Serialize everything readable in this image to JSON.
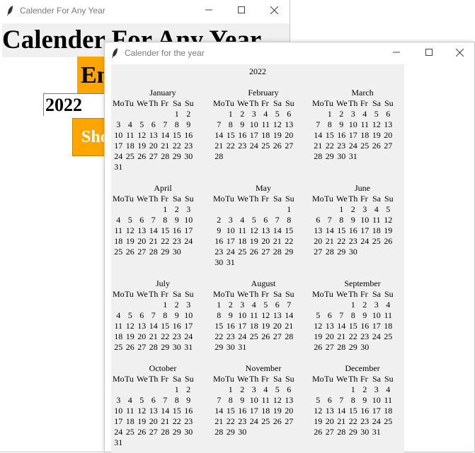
{
  "main_window": {
    "title": "Calender For Any Year",
    "heading": "Calender For Any Year",
    "enter_label": "Enter",
    "year_value": "2022",
    "show_button": "Show"
  },
  "calendar_window": {
    "title": "Calender for the year",
    "year": "2022",
    "day_names": [
      "Mo",
      "Tu",
      "We",
      "Th",
      "Fr",
      "Sa",
      "Su"
    ],
    "months": [
      {
        "name": "January",
        "weeks": [
          [
            "",
            "",
            "",
            "",
            "",
            "1",
            "2"
          ],
          [
            "3",
            "4",
            "5",
            "6",
            "7",
            "8",
            "9"
          ],
          [
            "10",
            "11",
            "12",
            "13",
            "14",
            "15",
            "16"
          ],
          [
            "17",
            "18",
            "19",
            "20",
            "21",
            "22",
            "23"
          ],
          [
            "24",
            "25",
            "26",
            "27",
            "28",
            "29",
            "30"
          ],
          [
            "31",
            "",
            "",
            "",
            "",
            "",
            ""
          ]
        ]
      },
      {
        "name": "February",
        "weeks": [
          [
            "",
            "1",
            "2",
            "3",
            "4",
            "5",
            "6"
          ],
          [
            "7",
            "8",
            "9",
            "10",
            "11",
            "12",
            "13"
          ],
          [
            "14",
            "15",
            "16",
            "17",
            "18",
            "19",
            "20"
          ],
          [
            "21",
            "22",
            "23",
            "24",
            "25",
            "26",
            "27"
          ],
          [
            "28",
            "",
            "",
            "",
            "",
            "",
            ""
          ]
        ]
      },
      {
        "name": "March",
        "weeks": [
          [
            "",
            "1",
            "2",
            "3",
            "4",
            "5",
            "6"
          ],
          [
            "7",
            "8",
            "9",
            "10",
            "11",
            "12",
            "13"
          ],
          [
            "14",
            "15",
            "16",
            "17",
            "18",
            "19",
            "20"
          ],
          [
            "21",
            "22",
            "23",
            "24",
            "25",
            "26",
            "27"
          ],
          [
            "28",
            "29",
            "30",
            "31",
            "",
            "",
            ""
          ]
        ]
      },
      {
        "name": "April",
        "weeks": [
          [
            "",
            "",
            "",
            "",
            "1",
            "2",
            "3"
          ],
          [
            "4",
            "5",
            "6",
            "7",
            "8",
            "9",
            "10"
          ],
          [
            "11",
            "12",
            "13",
            "14",
            "15",
            "16",
            "17"
          ],
          [
            "18",
            "19",
            "20",
            "21",
            "22",
            "23",
            "24"
          ],
          [
            "25",
            "26",
            "27",
            "28",
            "29",
            "30",
            ""
          ]
        ]
      },
      {
        "name": "May",
        "weeks": [
          [
            "",
            "",
            "",
            "",
            "",
            "",
            "1"
          ],
          [
            "2",
            "3",
            "4",
            "5",
            "6",
            "7",
            "8"
          ],
          [
            "9",
            "10",
            "11",
            "12",
            "13",
            "14",
            "15"
          ],
          [
            "16",
            "17",
            "18",
            "19",
            "20",
            "21",
            "22"
          ],
          [
            "23",
            "24",
            "25",
            "26",
            "27",
            "28",
            "29"
          ],
          [
            "30",
            "31",
            "",
            "",
            "",
            "",
            ""
          ]
        ]
      },
      {
        "name": "June",
        "weeks": [
          [
            "",
            "",
            "1",
            "2",
            "3",
            "4",
            "5"
          ],
          [
            "6",
            "7",
            "8",
            "9",
            "10",
            "11",
            "12"
          ],
          [
            "13",
            "14",
            "15",
            "16",
            "17",
            "18",
            "19"
          ],
          [
            "20",
            "21",
            "22",
            "23",
            "24",
            "25",
            "26"
          ],
          [
            "27",
            "28",
            "29",
            "30",
            "",
            "",
            ""
          ]
        ]
      },
      {
        "name": "July",
        "weeks": [
          [
            "",
            "",
            "",
            "",
            "1",
            "2",
            "3"
          ],
          [
            "4",
            "5",
            "6",
            "7",
            "8",
            "9",
            "10"
          ],
          [
            "11",
            "12",
            "13",
            "14",
            "15",
            "16",
            "17"
          ],
          [
            "18",
            "19",
            "20",
            "21",
            "22",
            "23",
            "24"
          ],
          [
            "25",
            "26",
            "27",
            "28",
            "29",
            "30",
            "31"
          ]
        ]
      },
      {
        "name": "August",
        "weeks": [
          [
            "1",
            "2",
            "3",
            "4",
            "5",
            "6",
            "7"
          ],
          [
            "8",
            "9",
            "10",
            "11",
            "12",
            "13",
            "14"
          ],
          [
            "15",
            "16",
            "17",
            "18",
            "19",
            "20",
            "21"
          ],
          [
            "22",
            "23",
            "24",
            "25",
            "26",
            "27",
            "28"
          ],
          [
            "29",
            "30",
            "31",
            "",
            "",
            "",
            ""
          ]
        ]
      },
      {
        "name": "September",
        "weeks": [
          [
            "",
            "",
            "",
            "1",
            "2",
            "3",
            "4"
          ],
          [
            "5",
            "6",
            "7",
            "8",
            "9",
            "10",
            "11"
          ],
          [
            "12",
            "13",
            "14",
            "15",
            "16",
            "17",
            "18"
          ],
          [
            "19",
            "20",
            "21",
            "22",
            "23",
            "24",
            "25"
          ],
          [
            "26",
            "27",
            "28",
            "29",
            "30",
            "",
            ""
          ]
        ]
      },
      {
        "name": "October",
        "weeks": [
          [
            "",
            "",
            "",
            "",
            "",
            "1",
            "2"
          ],
          [
            "3",
            "4",
            "5",
            "6",
            "7",
            "8",
            "9"
          ],
          [
            "10",
            "11",
            "12",
            "13",
            "14",
            "15",
            "16"
          ],
          [
            "17",
            "18",
            "19",
            "20",
            "21",
            "22",
            "23"
          ],
          [
            "24",
            "25",
            "26",
            "27",
            "28",
            "29",
            "30"
          ],
          [
            "31",
            "",
            "",
            "",
            "",
            "",
            ""
          ]
        ]
      },
      {
        "name": "November",
        "weeks": [
          [
            "",
            "1",
            "2",
            "3",
            "4",
            "5",
            "6"
          ],
          [
            "7",
            "8",
            "9",
            "10",
            "11",
            "12",
            "13"
          ],
          [
            "14",
            "15",
            "16",
            "17",
            "18",
            "19",
            "20"
          ],
          [
            "21",
            "22",
            "23",
            "24",
            "25",
            "26",
            "27"
          ],
          [
            "28",
            "29",
            "30",
            "",
            "",
            "",
            ""
          ]
        ]
      },
      {
        "name": "December",
        "weeks": [
          [
            "",
            "",
            "",
            "1",
            "2",
            "3",
            "4"
          ],
          [
            "5",
            "6",
            "7",
            "8",
            "9",
            "10",
            "11"
          ],
          [
            "12",
            "13",
            "14",
            "15",
            "16",
            "17",
            "18"
          ],
          [
            "19",
            "20",
            "21",
            "22",
            "23",
            "24",
            "25"
          ],
          [
            "26",
            "27",
            "28",
            "29",
            "30",
            "31",
            ""
          ]
        ]
      }
    ]
  }
}
